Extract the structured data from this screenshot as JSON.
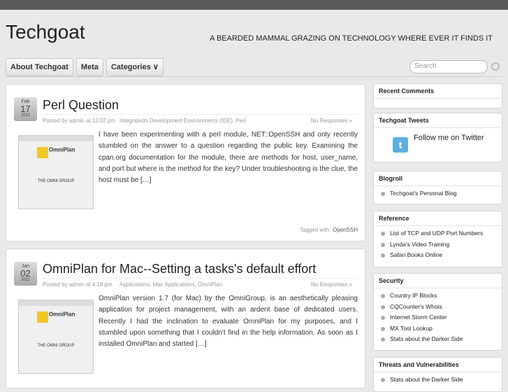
{
  "site": {
    "title": "Techgoat",
    "tagline": "A BEARDED MAMMAL GRAZING ON TECHNOLOGY WHERE EVER IT FINDS IT"
  },
  "nav": [
    "About Techgoat",
    "Meta",
    "Categories ∨"
  ],
  "search": {
    "placeholder": "Search"
  },
  "posts": [
    {
      "month": "Feb",
      "day": "17",
      "year": "2011",
      "title": "Perl Question",
      "posted": "Posted by admin at 12:02 pm",
      "categories": "Integratedn Development Environments (IDE), Perl",
      "responses": "No Responses »",
      "excerpt": "I have been experimenting with a perl module, NET::OpenSSH and only recently stumbled on the answer to a question regarding the public key. Examining the cpan.org documentation for the module, there are methods for host, user_name, and port but where is the method for the key? Under troubleshooting is the clue, the host must be […]",
      "tagged_label": "Tagged with:",
      "tags": "OpenSSH",
      "thumb_name": "OmniPlan",
      "thumb_company": "THE OMNI GROUP"
    },
    {
      "month": "Jan",
      "day": "02",
      "year": "2011",
      "title": "OmniPlan for Mac--Setting a tasks's default effort",
      "posted": "Posted by admin at 4:18 pm",
      "categories": "Applications, Mac Applications, OmniPlan",
      "responses": "No Responses »",
      "excerpt": "OmniPlan version 1.7 (for Mac) by the OmniGroup, is an aesthetically pleasing application for project management, with an ardent base of dedicated users. Recently I had the inclination to evaluate OmniPlan for my purposes, and I stumbled upon something that I couldn't find in the help information. As soon as I installed OmniPlan and started […]",
      "thumb_name": "OmniPlan",
      "thumb_company": "THE OMNI GROUP"
    }
  ],
  "sidebar": {
    "recent_comments": "Recent Comments",
    "tweets": {
      "title": "Techgoat Tweets",
      "follow": "Follow me on Twitter"
    },
    "blogroll": {
      "title": "Blogroll",
      "items": [
        "Techgoat's Personal Blog"
      ]
    },
    "reference": {
      "title": "Reference",
      "items": [
        "List of TCP and UDP Port Numbers",
        "Lynda's Video Training",
        "Safari Books Online"
      ]
    },
    "security": {
      "title": "Security",
      "items": [
        "Country IP Blocks",
        "CQCounter's Whois",
        "Internet Storm Center",
        "MX Tool Lookup",
        "Stats about the Darker Side"
      ]
    },
    "threats": {
      "title": "Threats and Vulnerabilities",
      "items": [
        "Stats about the Darker Side"
      ]
    }
  }
}
